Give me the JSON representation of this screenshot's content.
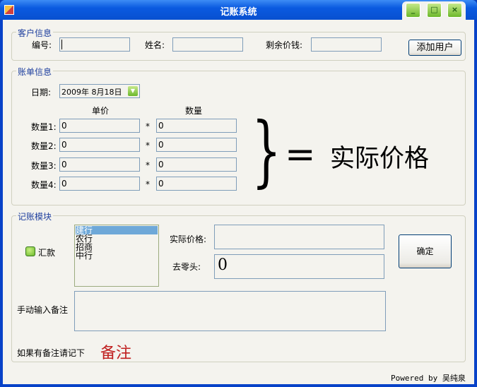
{
  "window": {
    "title": "记账系统"
  },
  "customer": {
    "group_label": "客户信息",
    "id_label": "编号:",
    "name_label": "姓名:",
    "balance_label": "剩余价钱:",
    "id_value": "",
    "name_value": "",
    "balance_value": "",
    "add_button": "添加用户"
  },
  "bill": {
    "group_label": "账单信息",
    "date_label": "日期:",
    "date_value": "2009年  8月18日",
    "unit_price_header": "单价",
    "quantity_header": "数量",
    "multiply": "*",
    "rows": [
      {
        "label": "数量1:",
        "price": "0",
        "qty": "0"
      },
      {
        "label": "数量2:",
        "price": "0",
        "qty": "0"
      },
      {
        "label": "数量3:",
        "price": "0",
        "qty": "0"
      },
      {
        "label": "数量4:",
        "price": "0",
        "qty": "0"
      }
    ],
    "brace": "}",
    "equals": "=",
    "result_text": "实际价格"
  },
  "record": {
    "group_label": "记账模块",
    "remit_label": "汇款",
    "banks": [
      "建行",
      "农行",
      "招商",
      "中行"
    ],
    "selected_bank": "建行",
    "actual_price_label": "实际价格:",
    "actual_price_value": "",
    "round_label": "去零头:",
    "round_value": "0",
    "confirm_button": "确定",
    "note_label": "手动输入备注",
    "note_value": "",
    "hint_label": "如果有备注请记下",
    "note_title": "备注"
  },
  "footer": {
    "powered": "Powered by 吴纯泉"
  },
  "colors": {
    "accent": "#0a5ae0",
    "note": "#c02020"
  }
}
